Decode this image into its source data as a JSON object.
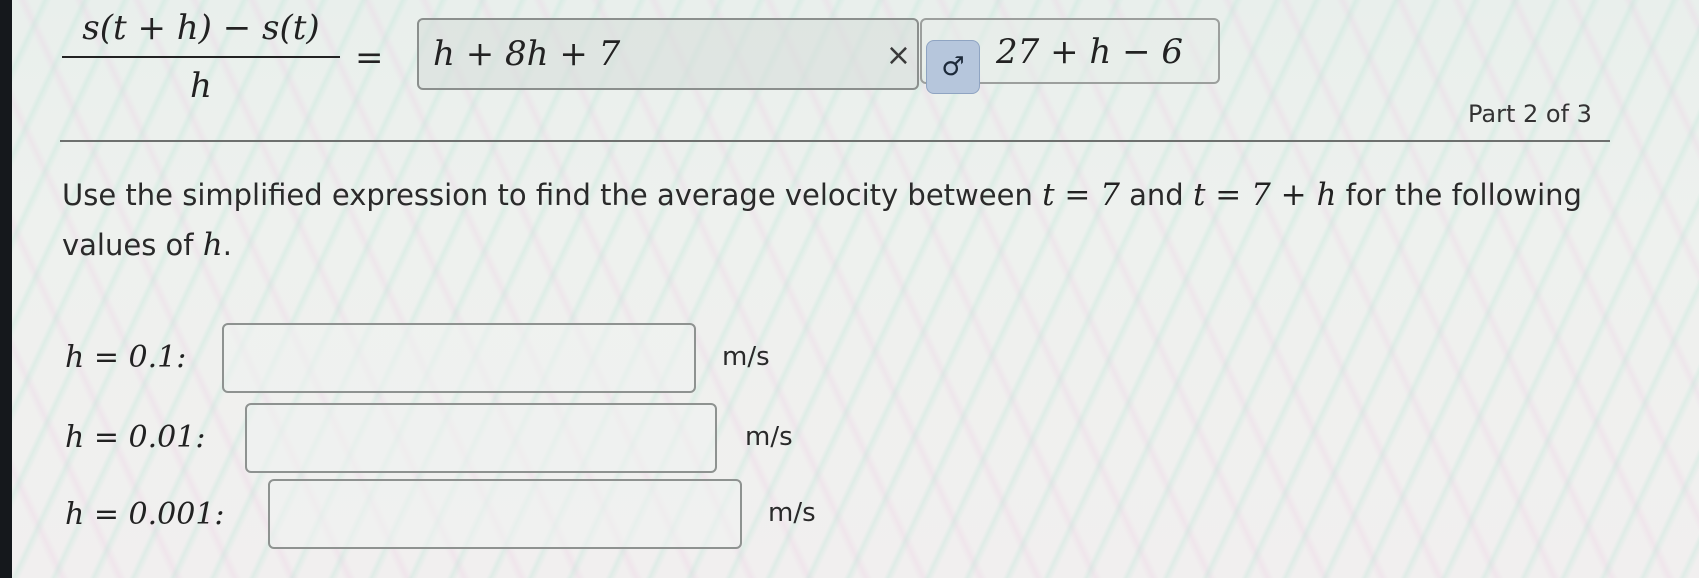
{
  "previous": {
    "numerator": "s(t + h) − s(t)",
    "denominator": "h",
    "equals": "=",
    "entered_answer": "h + 8h + 7",
    "incorrect_mark": "×",
    "hint_icon": "♂",
    "correct_answer": "27 + h − 6"
  },
  "part": {
    "label": "Part 2 of 3"
  },
  "question": {
    "text_1": "Use the simplified expression to find the average velocity between",
    "math_1": "t = 7",
    "text_2": "and",
    "math_2": "t = 7 + h",
    "text_3": "for the following values of",
    "math_3": "h",
    "text_4": "."
  },
  "inputs": [
    {
      "label": "h = 0.1:",
      "value": "",
      "unit": "m/s"
    },
    {
      "label": "h = 0.01:",
      "value": "",
      "unit": "m/s"
    },
    {
      "label": "h = 0.001:",
      "value": "",
      "unit": "m/s"
    }
  ]
}
